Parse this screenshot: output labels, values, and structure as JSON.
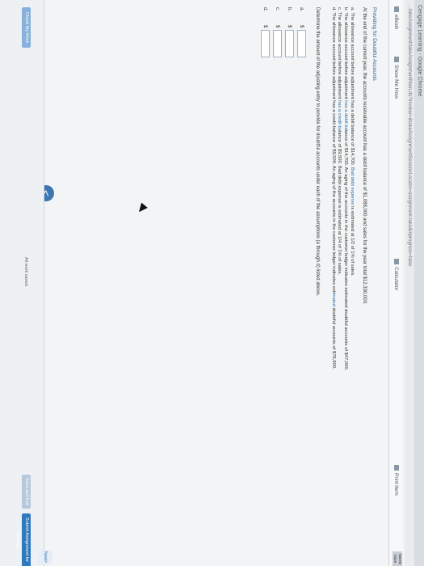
{
  "browser": {
    "window_title": "Cengage Learning - Google Chrome",
    "url": "...takeAssignment/takeAssignmentMain.do?invoker=&takeAssignmentSessionLocator=assignment-take&inprogress=false"
  },
  "toolbar": {
    "ebook": "eBook",
    "show_me_how": "Show Me How",
    "calculator": "Calculator",
    "print_item": "Print Item"
  },
  "problem": {
    "title": "Providing for Doubtful Accounts",
    "intro": "At the end of the current year, the accounts receivable account has a debit balance of $1,088,000 and sales for the year total $12,330,000.",
    "items": [
      {
        "letter": "a.",
        "pre": "The allowance account before adjustment has a debit balance of $14,700. ",
        "em": "Bad debt expense",
        "post": " is estimated at 1/2 of 1% of sales."
      },
      {
        "letter": "b.",
        "pre": "The allowance account before adjustment ",
        "em": "has a debit ba",
        "post": "lance of $14,700. An aging of the accounts in the customer ledger indicates estimated doubtful accounts of $47,000."
      },
      {
        "letter": "c.",
        "pre": "The allowance account before adjustment ",
        "em": "has a credit ba",
        "post": "lance of $9,500. Bad debt expense is estimated at 1/4 of 1% of sales."
      },
      {
        "letter": "d.",
        "pre": "The allowance account before adjustment has a credit balance of $9,500. An aging of the accounts in the customer ledger indicates esti",
        "em": "mated",
        "post": " doubtful accounts of $78,900."
      }
    ],
    "determine": "Determine the amount of the adjusting entry to provide for doubtful accounts under each of the assumptions (a through d) listed above.",
    "answers": [
      {
        "label": "a.",
        "currency": "$",
        "value": ""
      },
      {
        "label": "b.",
        "currency": "$",
        "value": ""
      },
      {
        "label": "c.",
        "currency": "$",
        "value": ""
      },
      {
        "label": "d.",
        "currency": "$",
        "value": ""
      }
    ]
  },
  "footer": {
    "check_my_work": "Check My Work",
    "all_saved": "All work saved.",
    "save_and_exit": "Save and Exit",
    "submit": "Submit Assignment for Grading",
    "next": "Next",
    "prev_glyph": "<",
    "next_glyph": ">"
  },
  "corner": {
    "a": "Saved",
    "b": "Save"
  }
}
